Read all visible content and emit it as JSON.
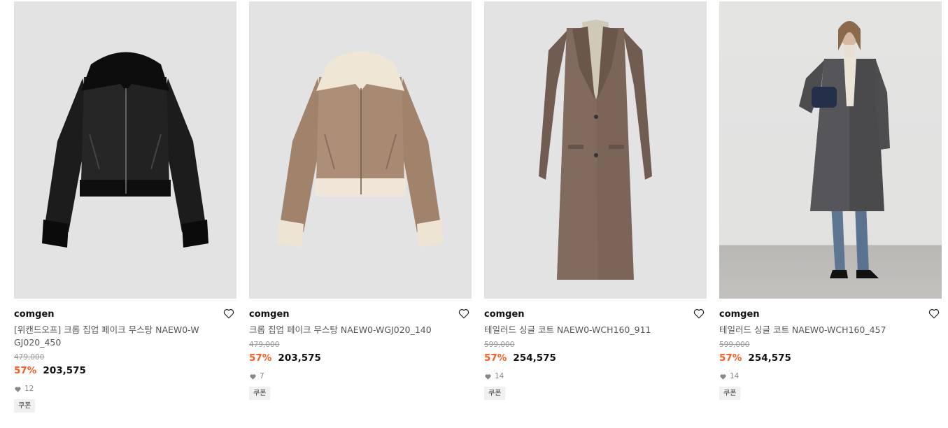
{
  "products": [
    {
      "brand": "comgen",
      "title": "[위캔드오프] 크롭 집업 페이크 무스탕 NAEW0-WGJ020_450",
      "original_price": "479,000",
      "discount": "57%",
      "price": "203,575",
      "likes": "12",
      "badge": "쿠폰",
      "image_alt": "black faux leather cropped shearling jacket"
    },
    {
      "brand": "comgen",
      "title": "크롭 집업 페이크 무스탕 NAEW0-WGJ020_140",
      "original_price": "479,000",
      "discount": "57%",
      "price": "203,575",
      "likes": "7",
      "badge": "쿠폰",
      "image_alt": "brown faux leather cropped jacket with cream shearling collar"
    },
    {
      "brand": "comgen",
      "title": "테일러드 싱글 코트 NAEW0-WCH160_911",
      "original_price": "599,000",
      "discount": "57%",
      "price": "254,575",
      "likes": "14",
      "badge": "쿠폰",
      "image_alt": "brown long tailored single coat"
    },
    {
      "brand": "comgen",
      "title": "테일러드 싱글 코트 NAEW0-WCH160_457",
      "original_price": "599,000",
      "discount": "57%",
      "price": "254,575",
      "likes": "14",
      "badge": "쿠폰",
      "image_alt": "model wearing grey herringbone long tailored coat"
    }
  ],
  "colors": {
    "discount": "#ff5a1f",
    "image_bg": "#e3e3e3"
  },
  "icons": {
    "wishlist": "heart-outline-icon",
    "likes": "heart-filled-icon"
  }
}
